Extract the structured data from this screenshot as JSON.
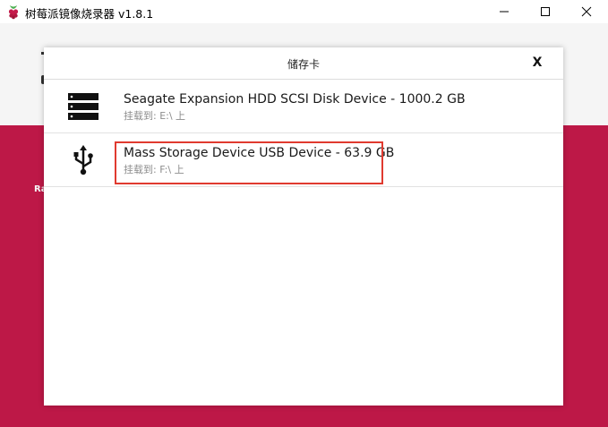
{
  "app": {
    "title": "树莓派镜像烧录器 v1.8.1",
    "icon": "raspberry-icon"
  },
  "window_controls": {
    "minimize": "minimize-icon",
    "maximize": "maximize-icon",
    "close": "close-icon"
  },
  "background": {
    "peek_text": "Ra"
  },
  "dialog": {
    "title": "储存卡",
    "close_label": "X",
    "devices": [
      {
        "name": "Seagate Expansion HDD SCSI Disk Device - 1000.2 GB",
        "mount": "挂载到: E:\\ 上",
        "icon": "hard-drive-icon"
      },
      {
        "name": "Mass Storage Device USB Device - 63.9 GB",
        "mount": "挂载到: F:\\ 上",
        "icon": "usb-icon"
      }
    ]
  },
  "colors": {
    "accent": "#c51a4a",
    "highlight": "#e03a2f"
  }
}
